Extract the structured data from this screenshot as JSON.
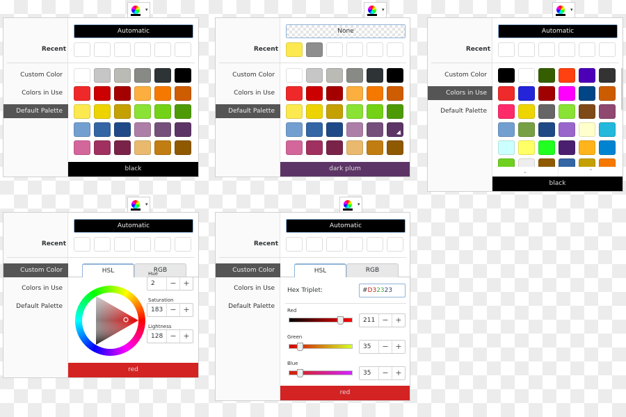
{
  "labels": {
    "automatic": "Automatic",
    "none": "None",
    "recent": "Recent",
    "custom_color": "Custom Color",
    "colors_in_use": "Colors in Use",
    "default_palette": "Default Palette",
    "hsl_tab": "HSL",
    "rgb_tab": "RGB",
    "hue": "Hue",
    "saturation": "Saturation",
    "lightness": "Lightness",
    "hex_triplet": "Hex Triplet:",
    "red": "Red",
    "green": "Green",
    "blue": "Blue",
    "minus": "−",
    "plus": "+",
    "dropdown_arrow": "▾",
    "scroll_down": "⌄",
    "scroll_up": "⌃"
  },
  "palettes": {
    "default": [
      "#ffffff",
      "#c6c6c6",
      "#babbb5",
      "#888a85",
      "#2e3436",
      "#000000",
      "#ef2929",
      "#cc0000",
      "#a40000",
      "#fcaf3e",
      "#f57900",
      "#ce5c00",
      "#fce94f",
      "#edd400",
      "#c4a000",
      "#8ae234",
      "#73d216",
      "#4e9a06",
      "#729fcf",
      "#3465a4",
      "#204a87",
      "#ad7fa8",
      "#75507b",
      "#5c3566",
      "#d3669a",
      "#a0305f",
      "#7a2349",
      "#e9b96e",
      "#c17d11",
      "#8f5902"
    ],
    "in_use": [
      "#000000",
      "#ffffff",
      "#355e00",
      "#ff4010",
      "#4b00b8",
      "#333333",
      "#ee2a2a",
      "#2424d9",
      "#a00000",
      "#ff00ff",
      "#004586",
      "#cc5c00",
      "#ff2a6a",
      "#eed500",
      "#666666",
      "#8ae234",
      "#7f4a18",
      "#8f4870",
      "#729fcf",
      "#77a046",
      "#1f4a86",
      "#9966cc",
      "#ffffcc",
      "#23b8dc",
      "#ccffff",
      "#ffff66",
      "#21ff21",
      "#4b1f6f",
      "#ffb41b",
      "#0084d1",
      "#6fd020",
      "#eeeeee",
      "#8f5a00",
      "#3465a4",
      "#c4a000",
      "#f57900"
    ]
  },
  "panels": [
    {
      "id": "p1",
      "mode": "default",
      "top_button": "automatic",
      "recent": [],
      "selected_section": "default_palette",
      "footer": {
        "name": "black",
        "color": "#000000"
      }
    },
    {
      "id": "p2",
      "mode": "default",
      "top_button": "none",
      "recent": [
        "#fce94f",
        "#8e8e8e"
      ],
      "selected_section": "default_palette",
      "hover_swatch": "dark plum",
      "footer": {
        "name": "dark plum",
        "color": "#5c3566"
      }
    },
    {
      "id": "p3",
      "mode": "in_use",
      "top_button": "automatic",
      "recent": [],
      "selected_section": "colors_in_use",
      "footer": {
        "name": "black",
        "color": "#000000"
      }
    },
    {
      "id": "p4",
      "mode": "hsl",
      "top_button": "automatic",
      "recent": [],
      "selected_section": "custom_color",
      "active_tab": "HSL",
      "hsl": {
        "hue": "2",
        "saturation": "183",
        "lightness": "128"
      },
      "footer": {
        "name": "red",
        "color": "#d32323"
      }
    },
    {
      "id": "p5",
      "mode": "rgb",
      "top_button": "automatic",
      "recent": [],
      "selected_section": "custom_color",
      "active_tab": "HSL",
      "hex": {
        "hash": "#",
        "r": "D3",
        "g": "23",
        "b": "23"
      },
      "rgb": {
        "red": "211",
        "green": "35",
        "blue": "35"
      },
      "footer": {
        "name": "red",
        "color": "#d32323"
      }
    }
  ]
}
